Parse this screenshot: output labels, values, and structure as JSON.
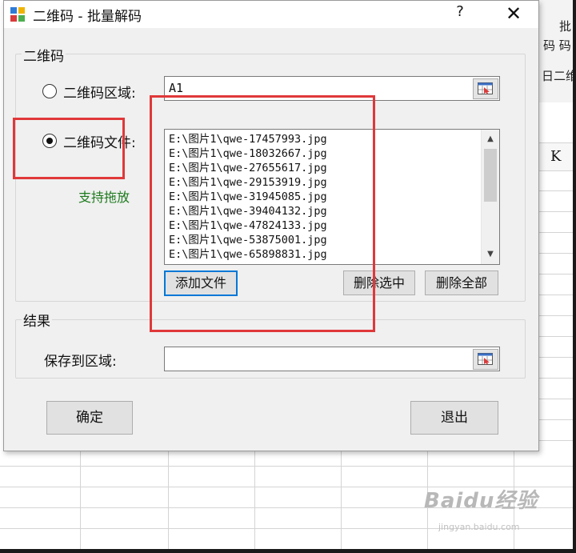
{
  "dialog": {
    "title": "二维码 - 批量解码",
    "help_label": "?",
    "close_label": "✕"
  },
  "qr_group": {
    "legend": "二维码",
    "region_option_label": "二维码区域:",
    "region_value": "A1",
    "file_option_label": "二维码文件:",
    "selected_option": "file",
    "drag_hint": "支持拖放",
    "files": [
      "E:\\图片1\\qwe-17457993.jpg",
      "E:\\图片1\\qwe-18032667.jpg",
      "E:\\图片1\\qwe-27655617.jpg",
      "E:\\图片1\\qwe-29153919.jpg",
      "E:\\图片1\\qwe-31945085.jpg",
      "E:\\图片1\\qwe-39404132.jpg",
      "E:\\图片1\\qwe-47824133.jpg",
      "E:\\图片1\\qwe-53875001.jpg",
      "E:\\图片1\\qwe-65898831.jpg"
    ],
    "add_file_label": "添加文件",
    "delete_selected_label": "删除选中",
    "delete_all_label": "删除全部"
  },
  "result_group": {
    "legend": "结果",
    "save_to_label": "保存到区域:",
    "save_to_value": ""
  },
  "footer": {
    "ok_label": "确定",
    "exit_label": "退出"
  },
  "background_sheet": {
    "ribbon_fragment_1": "批",
    "ribbon_fragment_2": "码 码 Z",
    "ribbon_fragment_3": "日二维",
    "column_header": "K",
    "watermark": "Baidu经验",
    "watermark_sub": "jingyan.baidu.com"
  },
  "colors": {
    "accent": "#0078d7",
    "highlight_box": "#e0383a",
    "hint_text": "#1e7a1e"
  },
  "icons": {
    "app": "qr-app-icon",
    "range_picker": "range-picker-icon",
    "scroll_up": "chevron-up-icon",
    "scroll_down": "chevron-down-icon"
  }
}
